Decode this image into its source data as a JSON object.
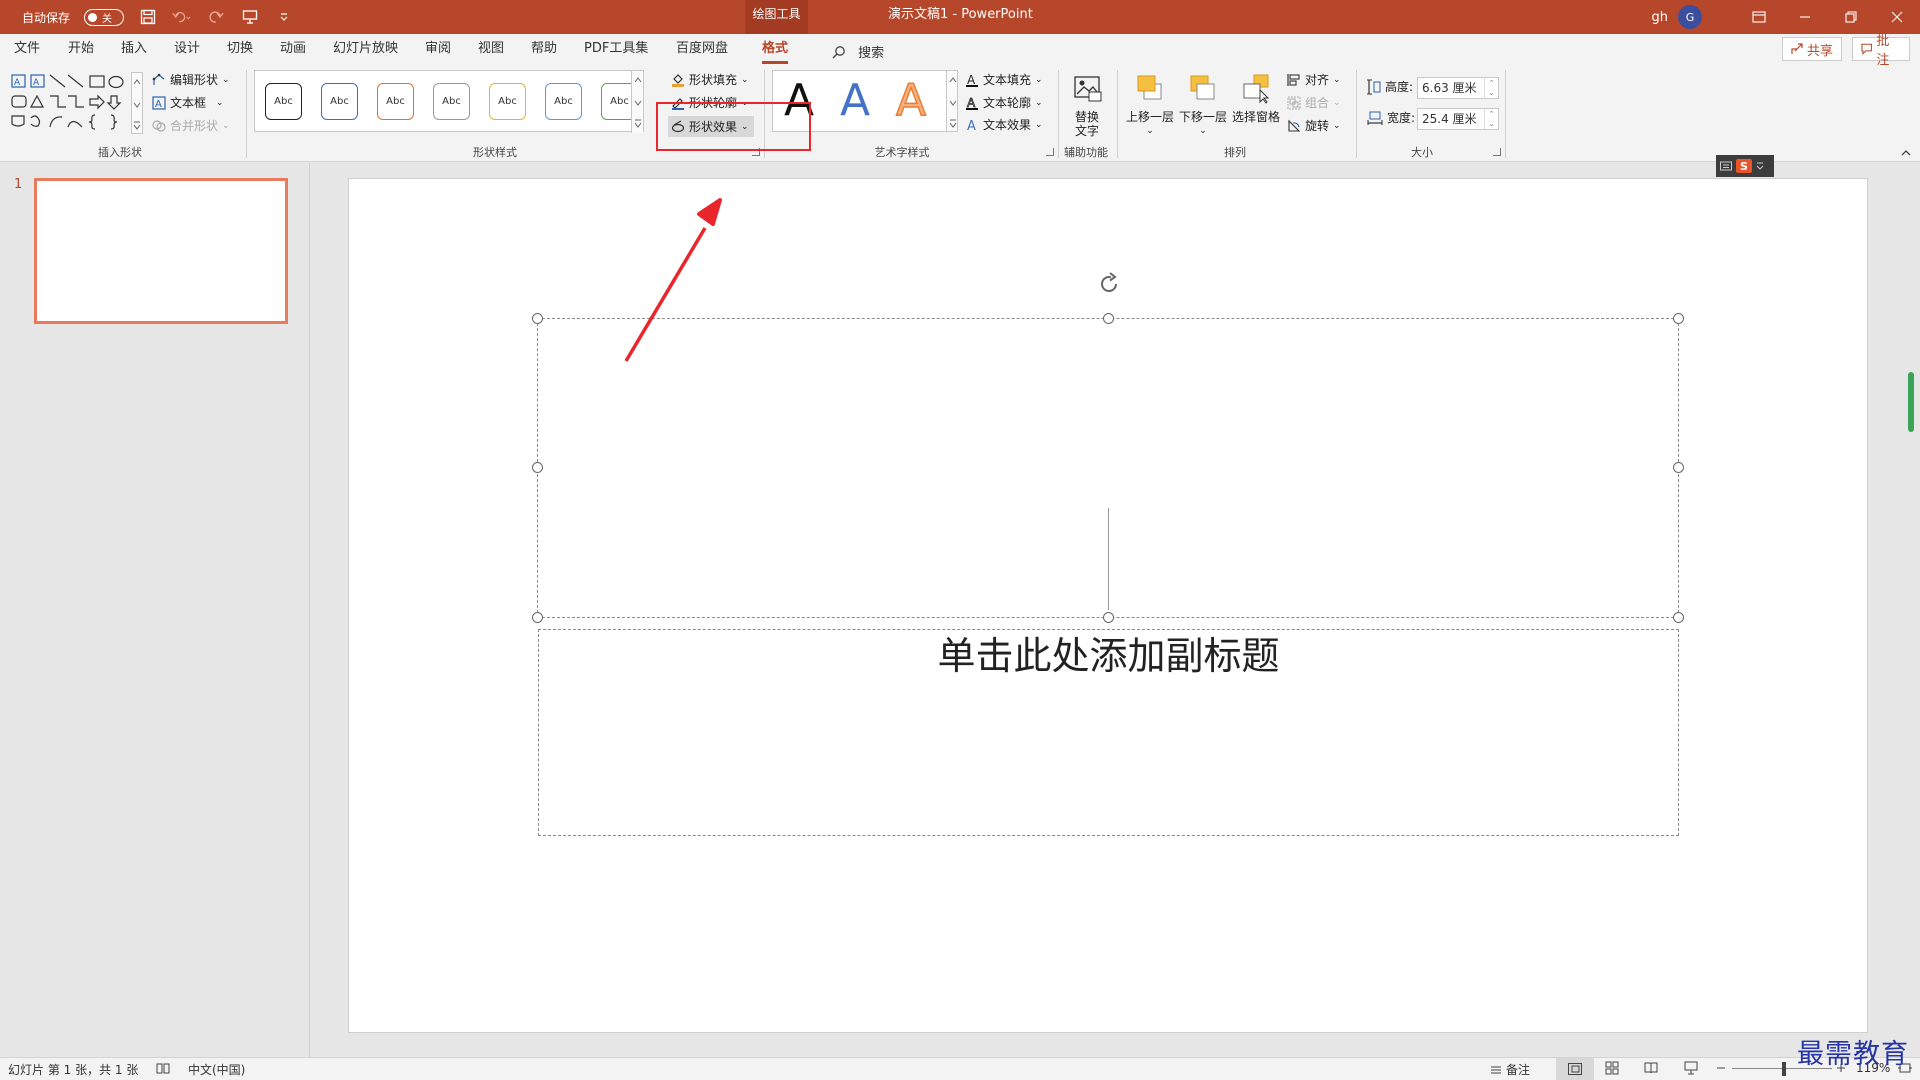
{
  "titlebar": {
    "autosave_label": "自动保存",
    "autosave_state": "关",
    "context_tab": "绘图工具",
    "doc_title": "演示文稿1  -  PowerPoint",
    "user_name": "gh",
    "avatar_initial": "G"
  },
  "tabs": [
    {
      "label": "文件",
      "active": false
    },
    {
      "label": "开始",
      "active": false
    },
    {
      "label": "插入",
      "active": false
    },
    {
      "label": "设计",
      "active": false
    },
    {
      "label": "切换",
      "active": false
    },
    {
      "label": "动画",
      "active": false
    },
    {
      "label": "幻灯片放映",
      "active": false
    },
    {
      "label": "审阅",
      "active": false
    },
    {
      "label": "视图",
      "active": false
    },
    {
      "label": "帮助",
      "active": false
    },
    {
      "label": "PDF工具集",
      "active": false
    },
    {
      "label": "百度网盘",
      "active": false
    },
    {
      "label": "格式",
      "active": true
    }
  ],
  "search_label": "搜索",
  "share_label": "共享",
  "comment_label": "批注",
  "ribbon": {
    "insert_shapes": {
      "edit_shape": "编辑形状",
      "text_box": "文本框",
      "merge_shapes": "合并形状",
      "label": "插入形状"
    },
    "shape_styles": {
      "style_sample": "Abc",
      "fill": "形状填充",
      "outline": "形状轮廓",
      "effects": "形状效果",
      "label": "形状样式"
    },
    "wordart": {
      "letter": "A",
      "text_fill": "文本填充",
      "text_outline": "文本轮廓",
      "text_effects": "文本效果",
      "label": "艺术字样式"
    },
    "accessibility": {
      "alt_text_line1": "替换",
      "alt_text_line2": "文字",
      "label": "辅助功能"
    },
    "arrange": {
      "bring_forward": "上移一层",
      "send_backward": "下移一层",
      "selection_pane": "选择窗格",
      "align": "对齐",
      "group": "组合",
      "rotate": "旋转",
      "label": "排列"
    },
    "size": {
      "height_label": "高度:",
      "height_value": "6.63 厘米",
      "width_label": "宽度:",
      "width_value": "25.4 厘米",
      "label": "大小"
    }
  },
  "thumbnails": {
    "slide_number": "1"
  },
  "slide": {
    "subtitle_placeholder": "单击此处添加副标题"
  },
  "statusbar": {
    "slide_info": "幻灯片 第 1 张，共 1 张",
    "language": "中文(中国)",
    "notes": "备注",
    "zoom": "119%"
  },
  "watermark": "最需教育",
  "colors": {
    "accent": "#b7472a",
    "highlight": "#e8262c",
    "arrow": "#e8262c"
  }
}
